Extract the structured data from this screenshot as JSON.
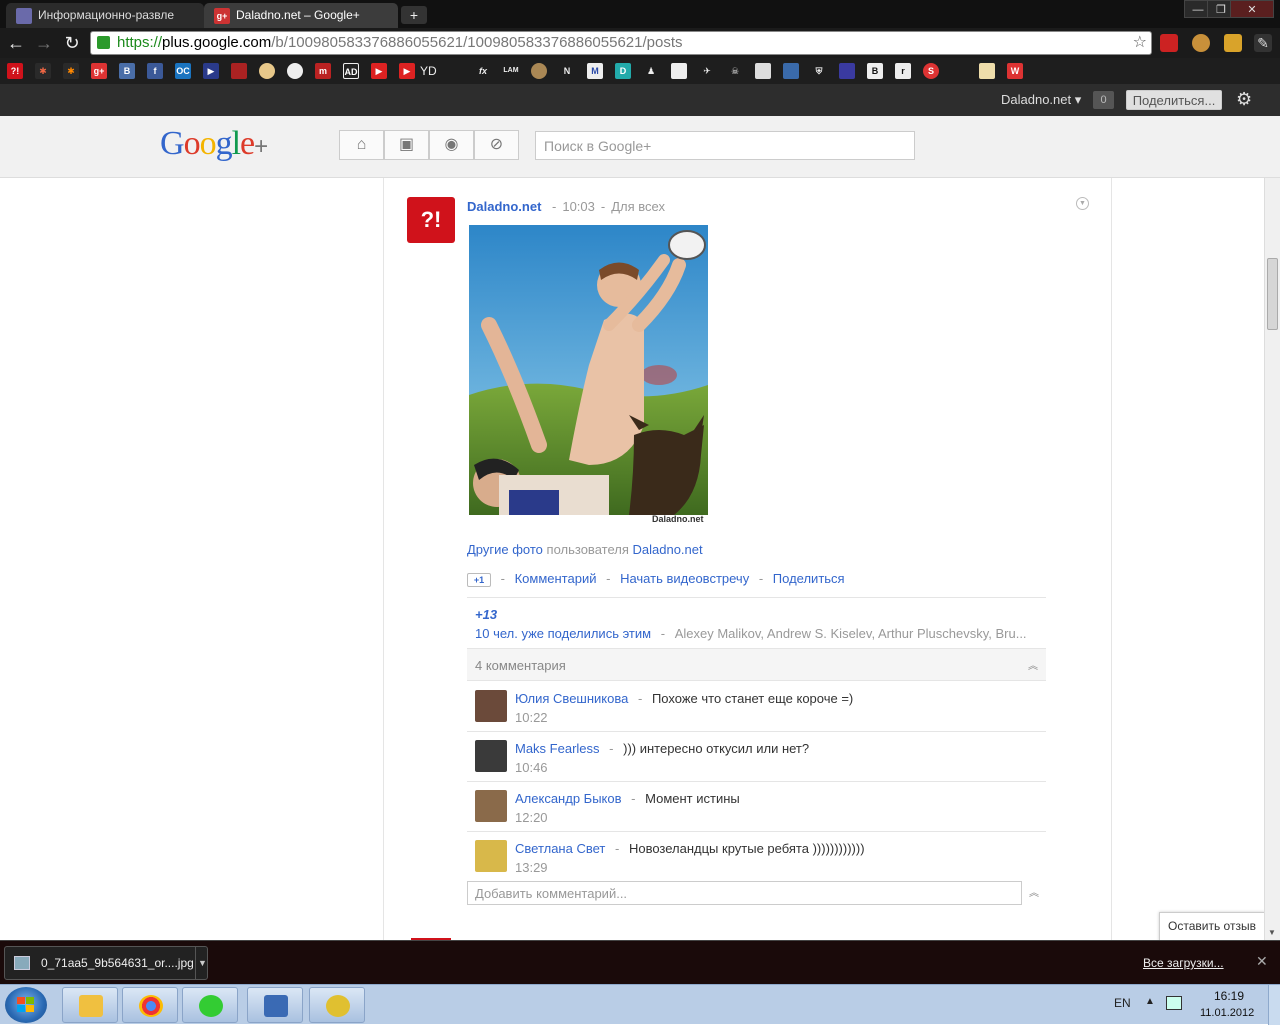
{
  "browser": {
    "tabs": [
      {
        "label": "Информационно-развле",
        "active": false
      },
      {
        "label": "Daladno.net – Google+",
        "active": true
      }
    ],
    "new_tab": "+",
    "window_buttons": {
      "minimize": "—",
      "maximize": "❐",
      "close": "✕"
    },
    "nav": {
      "back": "←",
      "forward": "→",
      "reload": "↻"
    },
    "url": {
      "scheme": "https://",
      "host": "plus.google.com",
      "path": "/b/100980583376886055621/100980583376886055621/posts"
    },
    "bookmark_text": "YD"
  },
  "gbar": {
    "user": "Daladno.net ▾",
    "notifications": "0",
    "share_button": "Поделиться..."
  },
  "header": {
    "logo": {
      "G": "G",
      "o1": "o",
      "o2": "o",
      "g": "g",
      "l": "l",
      "e": "e",
      "plus": "+"
    },
    "search_placeholder": "Поиск в Google+"
  },
  "post": {
    "avatar_text": "?!",
    "author": "Daladno.net",
    "time": "10:03",
    "visibility": "Для всех",
    "photo_credit": "Daladno.net",
    "other_photos_link": "Другие фото",
    "other_photos_text": "пользователя",
    "other_photos_user": "Daladno.net",
    "plus1_label": "+1",
    "actions": {
      "comment": "Комментарий",
      "hangout": "Начать видеовстречу",
      "share": "Поделиться"
    },
    "plus_count": "+13",
    "shares_link": "10 чел. уже поделились этим",
    "shares_people": "Alexey Malikov, Andrew S. Kiselev, Arthur Pluschevsky, Bru...",
    "comments_count": "4 комментария",
    "comments": [
      {
        "name": "Юлия Свешникова",
        "text": "Похоже что станет еще короче =)",
        "time": "10:22",
        "avatar_color": "#6b4a3a"
      },
      {
        "name": "Maks Fearless",
        "text": "))) интересно откусил или нет?",
        "time": "10:46",
        "avatar_color": "#3a3a3a"
      },
      {
        "name": "Александр Быков",
        "text": "Момент истины",
        "time": "12:20",
        "avatar_color": "#8a6a4a"
      },
      {
        "name": "Светлана Свет",
        "text": "Новозеландцы крутые ребята ))))))))))))",
        "time": "13:29",
        "avatar_color": "#d8b84a"
      }
    ],
    "add_comment_placeholder": "Добавить комментарий..."
  },
  "feedback_button": "Оставить отзыв",
  "download_shelf": {
    "file": "0_71aa5_9b564631_or....jpg",
    "show_all": "Все загрузки...",
    "close": "✕"
  },
  "taskbar": {
    "lang": "EN",
    "time": "16:19",
    "date": "11.01.2012"
  },
  "colors": {
    "accent_link": "#3366cc",
    "brand_red": "#d0121b"
  }
}
